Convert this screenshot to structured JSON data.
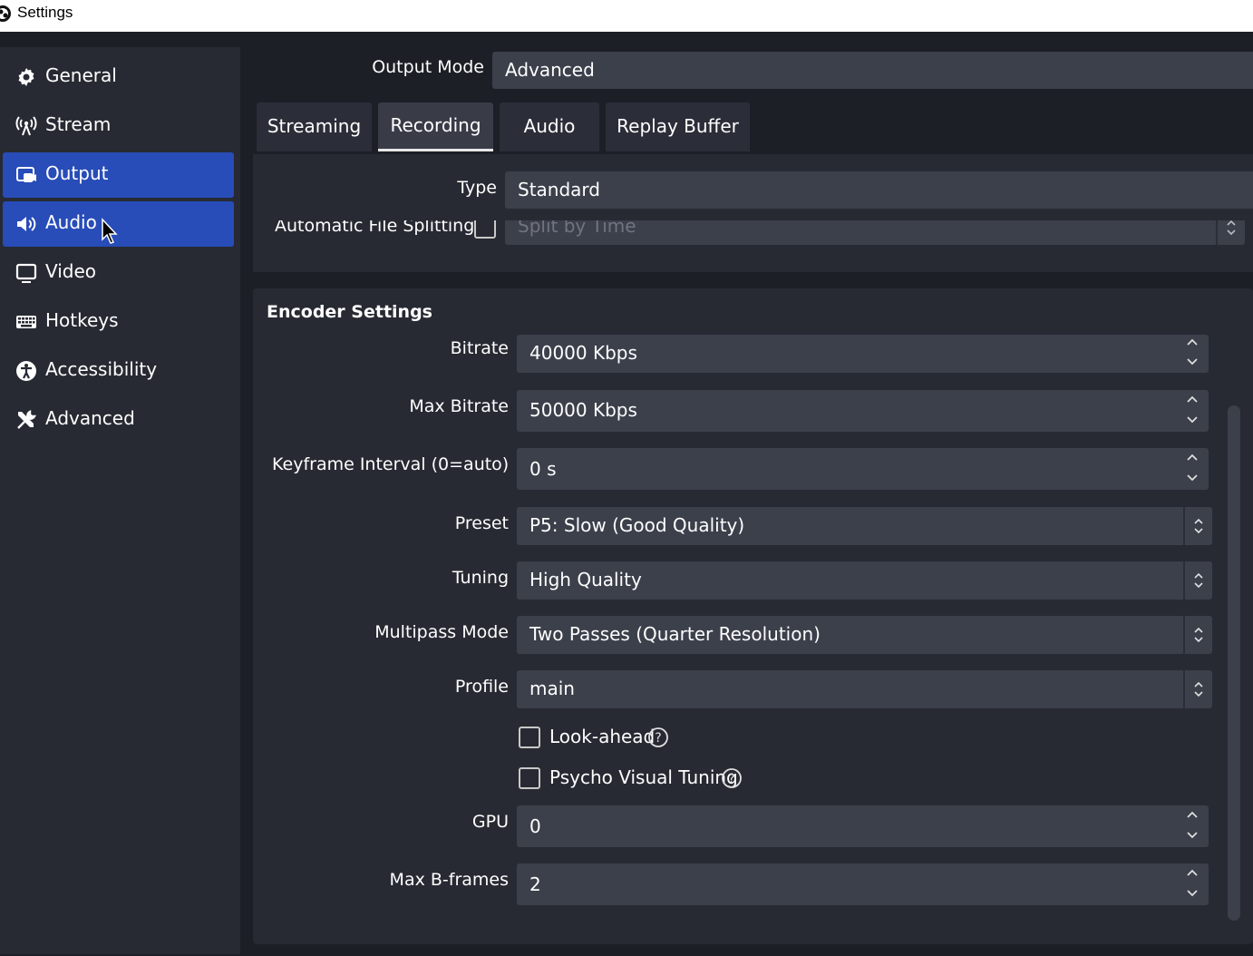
{
  "window": {
    "title": "Settings"
  },
  "sidebar": {
    "items": [
      {
        "label": "General",
        "icon": "gear-icon"
      },
      {
        "label": "Stream",
        "icon": "antenna-icon"
      },
      {
        "label": "Output",
        "icon": "output-icon",
        "active": true
      },
      {
        "label": "Audio",
        "icon": "speaker-icon",
        "hover": true
      },
      {
        "label": "Video",
        "icon": "monitor-icon"
      },
      {
        "label": "Hotkeys",
        "icon": "keyboard-icon"
      },
      {
        "label": "Accessibility",
        "icon": "accessibility-icon"
      },
      {
        "label": "Advanced",
        "icon": "tools-icon"
      }
    ]
  },
  "output_mode": {
    "label": "Output Mode",
    "value": "Advanced"
  },
  "tabs": [
    {
      "label": "Streaming"
    },
    {
      "label": "Recording",
      "active": true
    },
    {
      "label": "Audio"
    },
    {
      "label": "Replay Buffer"
    }
  ],
  "recording": {
    "type_label": "Type",
    "type_value": "Standard",
    "split_label": "Automatic File Splitting",
    "split_value": "Split by Time"
  },
  "encoder": {
    "heading": "Encoder Settings",
    "bitrate_label": "Bitrate",
    "bitrate_value": "40000 Kbps",
    "max_bitrate_label": "Max Bitrate",
    "max_bitrate_value": "50000 Kbps",
    "keyframe_label": "Keyframe Interval (0=auto)",
    "keyframe_value": "0 s",
    "preset_label": "Preset",
    "preset_value": "P5: Slow (Good Quality)",
    "tuning_label": "Tuning",
    "tuning_value": "High Quality",
    "multipass_label": "Multipass Mode",
    "multipass_value": "Two Passes (Quarter Resolution)",
    "profile_label": "Profile",
    "profile_value": "main",
    "lookahead_label": "Look-ahead",
    "psycho_label": "Psycho Visual Tuning",
    "gpu_label": "GPU",
    "gpu_value": "0",
    "bframes_label": "Max B-frames",
    "bframes_value": "2"
  },
  "colors": {
    "accent": "#284cb8",
    "background": "#1d1f26",
    "panel": "#272a33",
    "field": "#3c404b"
  }
}
